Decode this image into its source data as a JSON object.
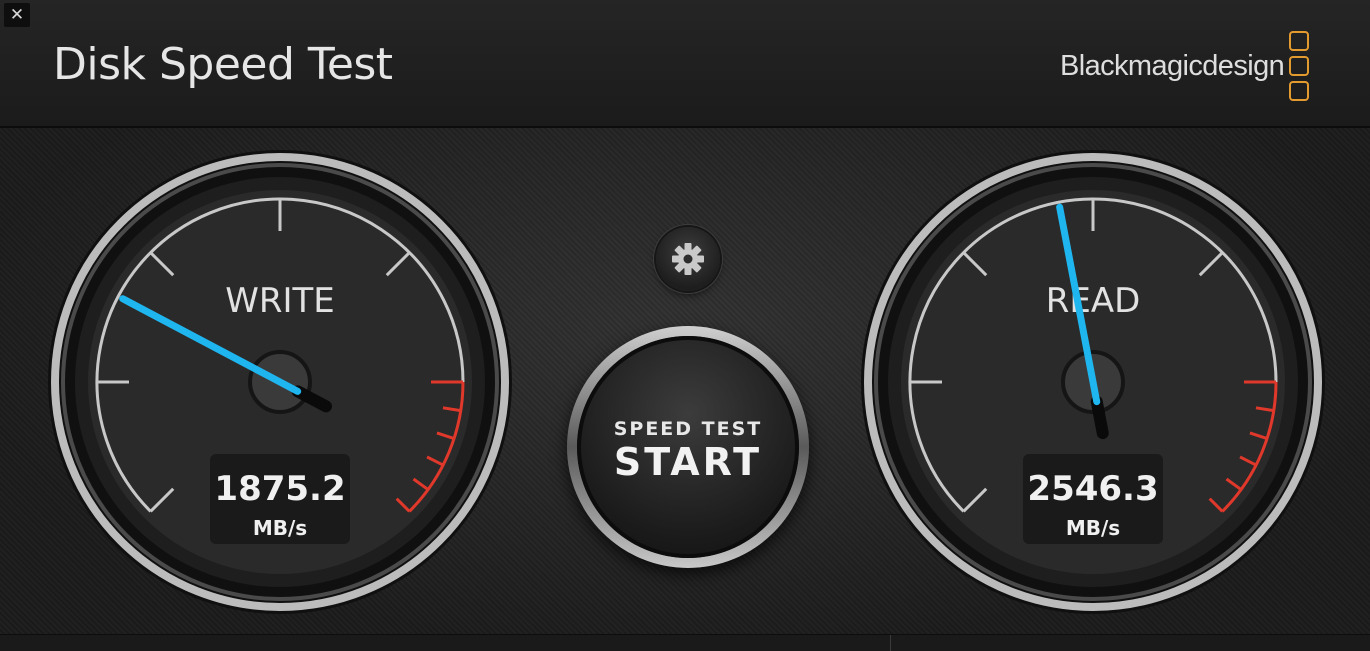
{
  "window": {
    "close_glyph": "✕"
  },
  "header": {
    "title": "Disk Speed Test",
    "brand": "Blackmagicdesign"
  },
  "colors": {
    "needle": "#1fb6ef",
    "redline": "#e0382a",
    "brand_accent": "#e39a2f"
  },
  "controls": {
    "settings_icon": "gear-icon",
    "start_small": "SPEED TEST",
    "start_big": "START"
  },
  "gauges": {
    "write": {
      "label": "WRITE",
      "value": "1875.2",
      "unit": "MB/s",
      "needle_fraction": 0.27
    },
    "read": {
      "label": "READ",
      "value": "2546.3",
      "unit": "MB/s",
      "needle_fraction": 0.46
    }
  }
}
